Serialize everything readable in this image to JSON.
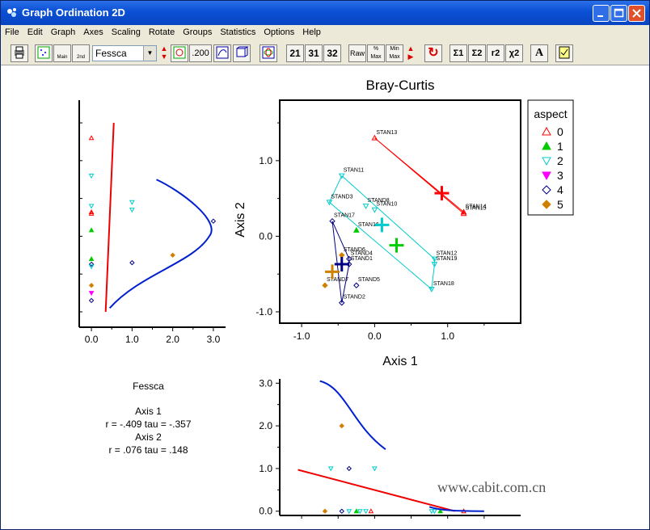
{
  "window": {
    "title": "Graph Ordination 2D"
  },
  "menu": [
    "File",
    "Edit",
    "Graph",
    "Axes",
    "Scaling",
    "Rotate",
    "Groups",
    "Statistics",
    "Options",
    "Help"
  ],
  "toolbar": {
    "variable": "Fessca",
    "scale_value": ".200",
    "btn_21": "21",
    "btn_31": "31",
    "btn_32": "32",
    "raw": "Raw",
    "pct_max": "% Max",
    "min_max": "Min Max",
    "sum1": "Σ1",
    "sum2": "Σ2",
    "r2": "r2",
    "chi2": "χ2",
    "font_a": "A"
  },
  "main_plot": {
    "title": "Bray-Curtis",
    "xlabel": "Axis 1",
    "ylabel": "Axis 2",
    "xticks": [
      "-1.0",
      "0.0",
      "1.0"
    ],
    "yticks": [
      "1.0",
      "0.0",
      "-1.0"
    ]
  },
  "legend": {
    "title": "aspect",
    "items": [
      {
        "label": "0",
        "color": "#ff0000",
        "shape": "triangle-up-open"
      },
      {
        "label": "1",
        "color": "#00cc00",
        "shape": "triangle-up-filled"
      },
      {
        "label": "2",
        "color": "#00cccc",
        "shape": "triangle-down-open"
      },
      {
        "label": "3",
        "color": "#ff00ff",
        "shape": "triangle-down-filled"
      },
      {
        "label": "4",
        "color": "#000080",
        "shape": "diamond-open"
      },
      {
        "label": "5",
        "color": "#d08000",
        "shape": "diamond-filled"
      }
    ]
  },
  "stand_labels": [
    "STAN13",
    "STAN14",
    "STAN15",
    "STAN11",
    "STAND3",
    "STAND8",
    "STAN10",
    "STAN12",
    "STAN19",
    "STAN18",
    "STAN16",
    "STAN17",
    "STAND4",
    "STAND1",
    "STAND2",
    "STAND6",
    "STAND7",
    "STAND5"
  ],
  "left_plot": {
    "xticks": [
      "0.0",
      "1.0",
      "2.0",
      "3.0"
    ]
  },
  "bottom_plot": {
    "yticks": [
      "3.0",
      "2.0",
      "1.0",
      "0.0"
    ]
  },
  "stats": {
    "variable": "Fessca",
    "axis1_title": "Axis 1",
    "axis1_stats": "r = -.409  tau = -.357",
    "axis2_title": "Axis 2",
    "axis2_stats": "r =  .076  tau =  .148"
  },
  "watermark": "www.cabit.com.cn",
  "chart_data": {
    "type": "scatter",
    "title": "Bray-Curtis",
    "xlabel": "Axis 1",
    "ylabel": "Axis 2",
    "xlim": [
      -1.3,
      2.0
    ],
    "ylim": [
      -1.15,
      1.8
    ],
    "group_by": "aspect",
    "points": [
      {
        "name": "STAN13",
        "x": 0.0,
        "y": 1.3,
        "group": "0"
      },
      {
        "name": "STAND1",
        "x": 1.22,
        "y": 0.32,
        "group": "0"
      },
      {
        "name": "STAND2",
        "x": 1.22,
        "y": 0.3,
        "group": "0"
      },
      {
        "name": "STAN14",
        "x": -0.45,
        "y": 0.8,
        "group": "2"
      },
      {
        "name": "STAN15",
        "x": -0.62,
        "y": 0.45,
        "group": "2"
      },
      {
        "name": "STAN11",
        "x": -0.12,
        "y": 0.4,
        "group": "2"
      },
      {
        "name": "STAND3",
        "x": 0.0,
        "y": 0.35,
        "group": "2"
      },
      {
        "name": "STAND6",
        "x": 0.82,
        "y": -0.3,
        "group": "2"
      },
      {
        "name": "STAND7",
        "x": 0.82,
        "y": -0.37,
        "group": "2"
      },
      {
        "name": "STAND5",
        "x": 0.78,
        "y": -0.7,
        "group": "2"
      },
      {
        "name": "STAN10",
        "x": -0.25,
        "y": 0.08,
        "group": "1"
      },
      {
        "name": "STAND8",
        "x": -0.58,
        "y": 0.2,
        "group": "4"
      },
      {
        "name": "STAN19",
        "x": -0.35,
        "y": -0.3,
        "group": "4"
      },
      {
        "name": "STAN18",
        "x": -0.35,
        "y": -0.37,
        "group": "4"
      },
      {
        "name": "STAN17",
        "x": -0.45,
        "y": -0.88,
        "group": "4"
      },
      {
        "name": "STAN12",
        "x": -0.45,
        "y": -0.25,
        "group": "5"
      },
      {
        "name": "STAN16",
        "x": -0.68,
        "y": -0.65,
        "group": "5"
      },
      {
        "name": "STAND4",
        "x": -0.25,
        "y": -0.65,
        "group": "4"
      }
    ],
    "centroids": [
      {
        "group": "0",
        "x": 0.92,
        "y": 0.57
      },
      {
        "group": "1",
        "x": 0.3,
        "y": -0.12
      },
      {
        "group": "2",
        "x": 0.1,
        "y": 0.15
      },
      {
        "group": "4",
        "x": -0.45,
        "y": -0.37
      },
      {
        "group": "5",
        "x": -0.58,
        "y": -0.47
      }
    ],
    "hulls": {
      "0": [
        [
          0.0,
          1.3
        ],
        [
          1.22,
          0.32
        ],
        [
          1.22,
          0.3
        ],
        [
          0.0,
          1.3
        ]
      ],
      "2": [
        [
          -0.45,
          0.8
        ],
        [
          0.82,
          -0.3
        ],
        [
          0.82,
          -0.37
        ],
        [
          0.78,
          -0.7
        ],
        [
          -0.62,
          0.45
        ],
        [
          -0.45,
          0.8
        ]
      ],
      "4": [
        [
          -0.58,
          0.2
        ],
        [
          -0.35,
          -0.3
        ],
        [
          -0.35,
          -0.37
        ],
        [
          -0.45,
          -0.88
        ],
        [
          -0.58,
          0.2
        ]
      ]
    },
    "left_overlay": {
      "xlim": [
        -0.3,
        3.3
      ],
      "xticks": [
        0,
        1,
        2,
        3
      ],
      "points": [
        {
          "x": 0,
          "y": 1.3,
          "group": "0"
        },
        {
          "x": 0,
          "y": 0.8,
          "group": "2"
        },
        {
          "x": 0,
          "y": 0.4,
          "group": "2"
        },
        {
          "x": 0,
          "y": 0.32,
          "group": "0"
        },
        {
          "x": 0,
          "y": 0.3,
          "group": "0"
        },
        {
          "x": 0,
          "y": 0.08,
          "group": "1"
        },
        {
          "x": 0,
          "y": -0.3,
          "group": "1"
        },
        {
          "x": 0,
          "y": -0.37,
          "group": "4"
        },
        {
          "x": 0,
          "y": -0.4,
          "group": "2"
        },
        {
          "x": 0,
          "y": -0.65,
          "group": "5"
        },
        {
          "x": 0,
          "y": -0.75,
          "group": "3"
        },
        {
          "x": 0,
          "y": -0.85,
          "group": "4"
        },
        {
          "x": 1,
          "y": 0.45,
          "group": "2"
        },
        {
          "x": 1,
          "y": 0.35,
          "group": "2"
        },
        {
          "x": 1,
          "y": -0.35,
          "group": "4"
        },
        {
          "x": 2,
          "y": -0.25,
          "group": "5"
        },
        {
          "x": 3,
          "y": 0.2,
          "group": "4"
        }
      ]
    },
    "bottom_overlay": {
      "ylim": [
        -0.1,
        3.1
      ],
      "yticks": [
        0,
        1,
        2,
        3
      ],
      "points": [
        {
          "x": -0.6,
          "y": 1,
          "group": "2"
        },
        {
          "x": -0.35,
          "y": 1,
          "group": "4"
        },
        {
          "x": 0,
          "y": 1,
          "group": "2"
        },
        {
          "x": -0.45,
          "y": 2,
          "group": "5"
        },
        {
          "x": -0.68,
          "y": 0,
          "group": "5"
        },
        {
          "x": -0.45,
          "y": 0,
          "group": "4"
        },
        {
          "x": -0.35,
          "y": 0,
          "group": "2"
        },
        {
          "x": -0.25,
          "y": 0,
          "group": "1"
        },
        {
          "x": -0.2,
          "y": 0,
          "group": "2"
        },
        {
          "x": -0.12,
          "y": 0,
          "group": "2"
        },
        {
          "x": -0.05,
          "y": 0,
          "group": "0"
        },
        {
          "x": 0.78,
          "y": 0,
          "group": "2"
        },
        {
          "x": 0.82,
          "y": 0,
          "group": "2"
        },
        {
          "x": 0.9,
          "y": 0,
          "group": "1"
        },
        {
          "x": 1.22,
          "y": 0,
          "group": "0"
        }
      ]
    }
  }
}
